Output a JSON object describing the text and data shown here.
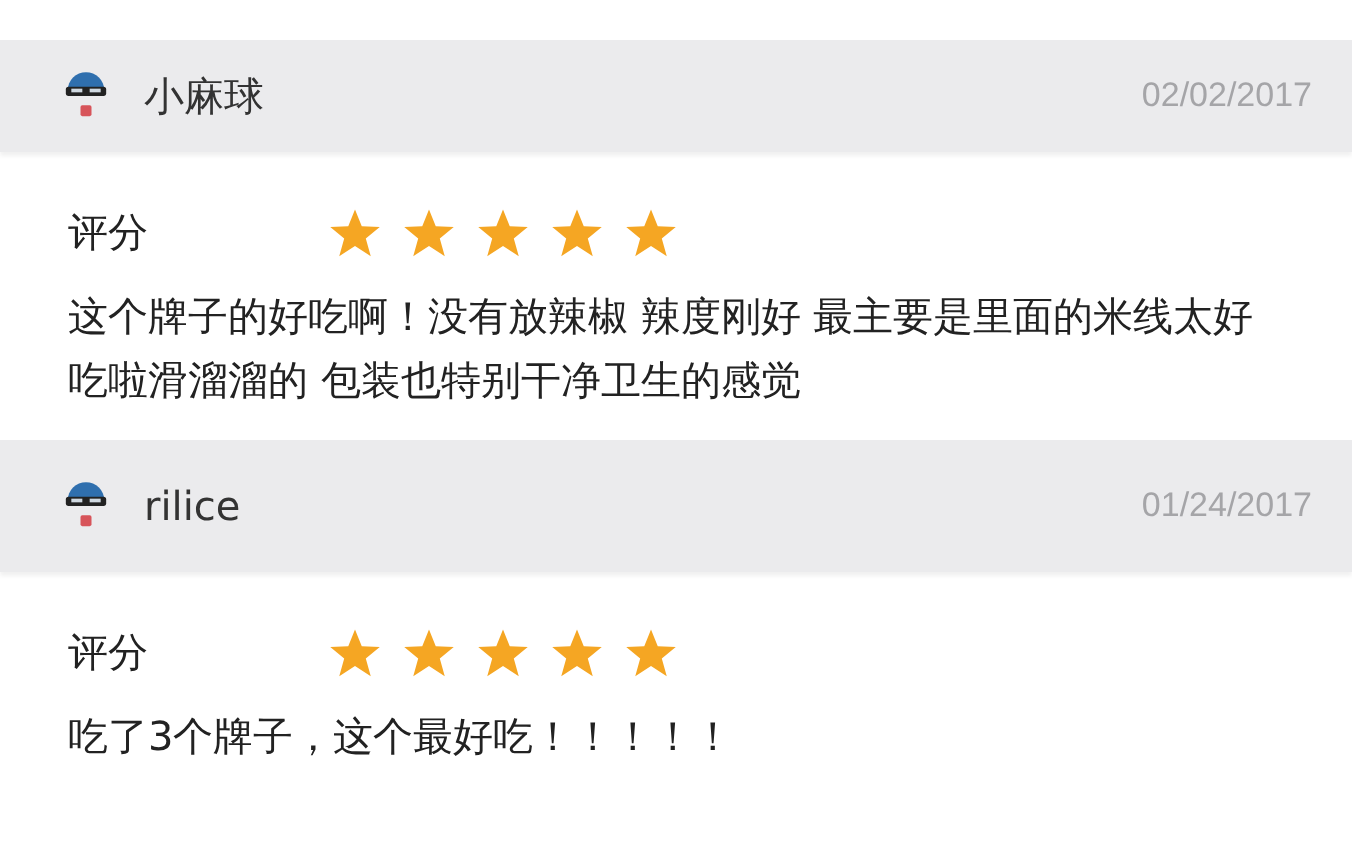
{
  "reviews": [
    {
      "user": "小麻球",
      "date": "02/02/2017",
      "rating_label": "评分",
      "stars": 5,
      "comment": "这个牌子的好吃啊！没有放辣椒 辣度刚好 最主要是里面的米线太好吃啦滑溜溜的 包装也特别干净卫生的感觉"
    },
    {
      "user": "rilice",
      "date": "01/24/2017",
      "rating_label": "评分",
      "stars": 5,
      "comment": "吃了3个牌子，这个最好吃！！！！！"
    }
  ]
}
